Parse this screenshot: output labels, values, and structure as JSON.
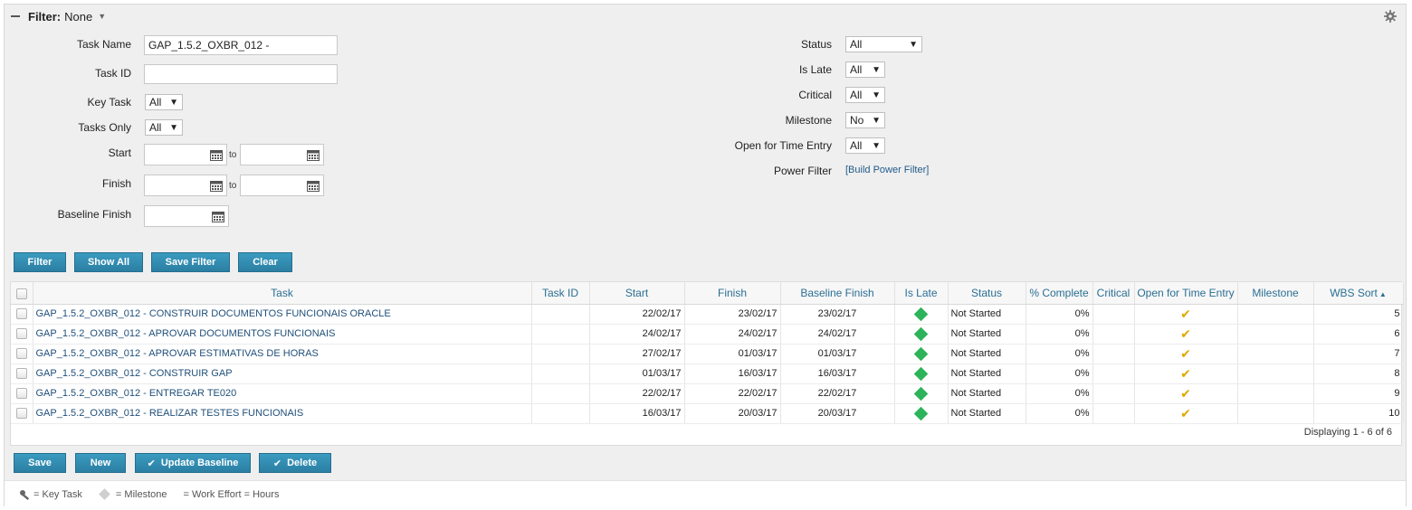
{
  "filter": {
    "title": "Filter:",
    "value": "None",
    "task_name": {
      "label": "Task Name",
      "value": "GAP_1.5.2_OXBR_012 -"
    },
    "task_id": {
      "label": "Task ID",
      "value": ""
    },
    "key_task": {
      "label": "Key Task",
      "value": "All"
    },
    "tasks_only": {
      "label": "Tasks Only",
      "value": "All"
    },
    "start": {
      "label": "Start",
      "to": "to"
    },
    "finish": {
      "label": "Finish",
      "to": "to"
    },
    "baseline_finish": {
      "label": "Baseline Finish"
    },
    "status": {
      "label": "Status",
      "value": "All"
    },
    "is_late": {
      "label": "Is Late",
      "value": "All"
    },
    "critical": {
      "label": "Critical",
      "value": "All"
    },
    "milestone": {
      "label": "Milestone",
      "value": "No"
    },
    "open_time_entry": {
      "label": "Open for Time Entry",
      "value": "All"
    },
    "power_filter": {
      "label": "Power Filter",
      "link": "[Build Power Filter]"
    }
  },
  "filter_buttons": {
    "filter": "Filter",
    "show_all": "Show All",
    "save_filter": "Save Filter",
    "clear": "Clear"
  },
  "grid": {
    "columns": [
      "Task",
      "Task ID",
      "Start",
      "Finish",
      "Baseline Finish",
      "Is Late",
      "Status",
      "% Complete",
      "Critical",
      "Open for Time Entry",
      "Milestone",
      "WBS Sort"
    ],
    "rows": [
      {
        "task": "GAP_1.5.2_OXBR_012 - CONSTRUIR DOCUMENTOS FUNCIONAIS ORACLE",
        "task_id": "",
        "start": "22/02/17",
        "finish": "23/02/17",
        "baseline_finish": "23/02/17",
        "status": "Not Started",
        "pct": "0%",
        "critical": "",
        "milestone": "",
        "wbs": "5"
      },
      {
        "task": "GAP_1.5.2_OXBR_012 - APROVAR DOCUMENTOS FUNCIONAIS",
        "task_id": "",
        "start": "24/02/17",
        "finish": "24/02/17",
        "baseline_finish": "24/02/17",
        "status": "Not Started",
        "pct": "0%",
        "critical": "",
        "milestone": "",
        "wbs": "6"
      },
      {
        "task": "GAP_1.5.2_OXBR_012 - APROVAR ESTIMATIVAS DE HORAS",
        "task_id": "",
        "start": "27/02/17",
        "finish": "01/03/17",
        "baseline_finish": "01/03/17",
        "status": "Not Started",
        "pct": "0%",
        "critical": "",
        "milestone": "",
        "wbs": "7"
      },
      {
        "task": "GAP_1.5.2_OXBR_012 - CONSTRUIR GAP",
        "task_id": "",
        "start": "01/03/17",
        "finish": "16/03/17",
        "baseline_finish": "16/03/17",
        "status": "Not Started",
        "pct": "0%",
        "critical": "",
        "milestone": "",
        "wbs": "8"
      },
      {
        "task": "GAP_1.5.2_OXBR_012 - ENTREGAR TE020",
        "task_id": "",
        "start": "22/02/17",
        "finish": "22/02/17",
        "baseline_finish": "22/02/17",
        "status": "Not Started",
        "pct": "0%",
        "critical": "",
        "milestone": "",
        "wbs": "9"
      },
      {
        "task": "GAP_1.5.2_OXBR_012 - REALIZAR TESTES FUNCIONAIS",
        "task_id": "",
        "start": "16/03/17",
        "finish": "20/03/17",
        "baseline_finish": "20/03/17",
        "status": "Not Started",
        "pct": "0%",
        "critical": "",
        "milestone": "",
        "wbs": "10"
      }
    ],
    "displaying": "Displaying 1 - 6 of 6"
  },
  "action_buttons": {
    "save": "Save",
    "new": "New",
    "update_baseline": "Update Baseline",
    "delete": "Delete"
  },
  "legend": {
    "key_task": "= Key Task",
    "milestone": "= Milestone",
    "work_effort": "= Work Effort = Hours"
  },
  "colors": {
    "accent": "#2b7fa3",
    "late_indicator": "#2db35a",
    "time_entry_check": "#e0a800"
  },
  "icons": [
    "collapse-icon",
    "gear-icon",
    "calendar-icon",
    "checkmark-icon",
    "key-icon",
    "milestone-diamond-icon",
    "sort-asc-icon"
  ]
}
